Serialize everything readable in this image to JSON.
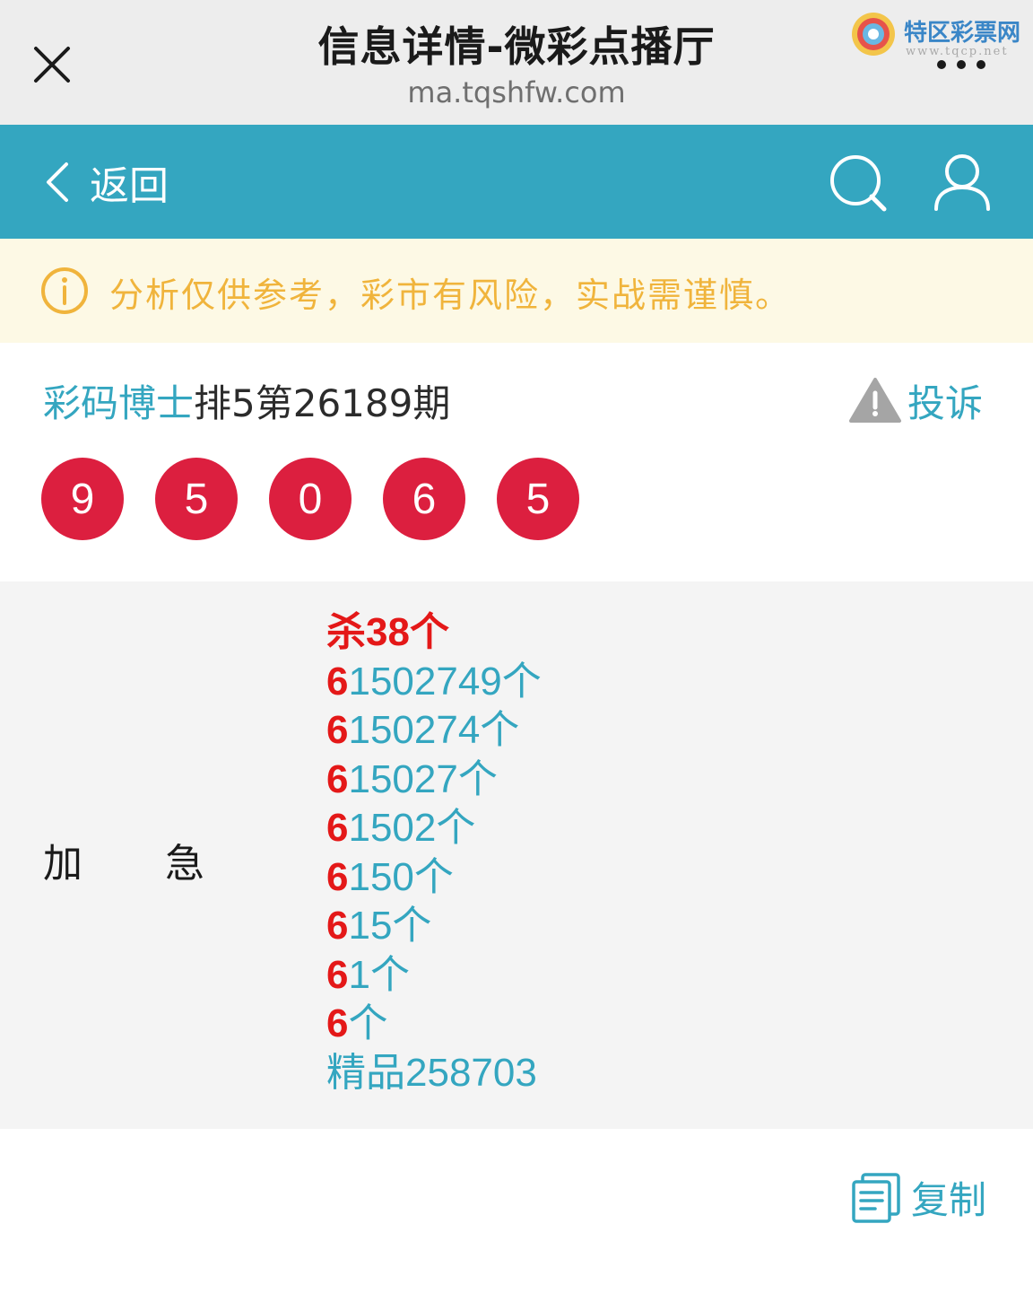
{
  "browser": {
    "title": "信息详情-微彩点播厅",
    "url": "ma.tqshfw.com",
    "watermark_name": "特区彩票网",
    "watermark_site": "www.tqcp.net"
  },
  "nav": {
    "back_label": "返回"
  },
  "notice": {
    "text": "分析仅供参考，彩市有风险，实战需谨慎。"
  },
  "header": {
    "author": "彩码博士",
    "issue": "排5第26189期",
    "complain_label": "投诉"
  },
  "balls": [
    "9",
    "5",
    "0",
    "6",
    "5"
  ],
  "prediction": {
    "label_left": "加",
    "label_right": "急",
    "kill": "杀38个",
    "rows": [
      {
        "head": "6",
        "rest": "1502749个"
      },
      {
        "head": "6",
        "rest": "150274个"
      },
      {
        "head": "6",
        "rest": "15027个"
      },
      {
        "head": "6",
        "rest": "1502个"
      },
      {
        "head": "6",
        "rest": "150个"
      },
      {
        "head": "6",
        "rest": "15个"
      },
      {
        "head": "6",
        "rest": "1个"
      },
      {
        "head": "6",
        "rest": "个"
      }
    ],
    "boutique": "精品258703"
  },
  "copy": {
    "label": "复制"
  },
  "colors": {
    "teal": "#34a6c0",
    "red": "#e41818",
    "ball": "#dc1f3f",
    "notice_text": "#f0b43c"
  }
}
